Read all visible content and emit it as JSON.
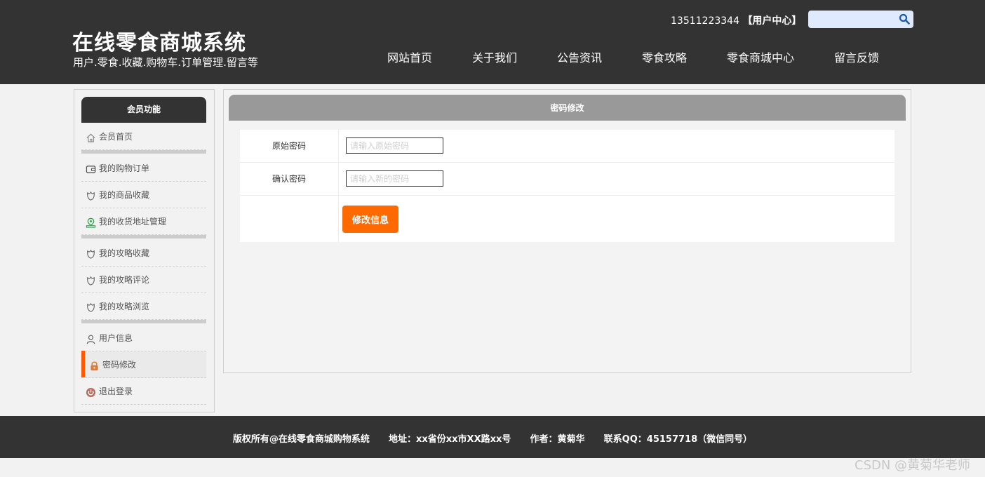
{
  "header": {
    "site_title": "在线零食商城系统",
    "site_subtitle": "用户.零食.收藏.购物车.订单管理.留言等",
    "user_phone": "13511223344",
    "user_center": "【用户中心】",
    "search_placeholder": "",
    "nav": [
      "网站首页",
      "关于我们",
      "公告资讯",
      "零食攻略",
      "零食商城中心",
      "留言反馈"
    ]
  },
  "sidebar": {
    "title": "会员功能",
    "items": [
      {
        "label": "会员首页",
        "icon": "home-icon"
      },
      {
        "label": "我的购物订单",
        "icon": "wallet-icon"
      },
      {
        "label": "我的商品收藏",
        "icon": "flower-icon"
      },
      {
        "label": "我的收货地址管理",
        "icon": "location-icon"
      },
      {
        "label": "我的攻略收藏",
        "icon": "flower-icon"
      },
      {
        "label": "我的攻略评论",
        "icon": "flower-icon"
      },
      {
        "label": "我的攻略浏览",
        "icon": "flower-icon"
      },
      {
        "label": "用户信息",
        "icon": "user-icon"
      },
      {
        "label": "密码修改",
        "icon": "lock-icon",
        "active": true
      },
      {
        "label": "退出登录",
        "icon": "power-icon"
      }
    ]
  },
  "main": {
    "panel_title": "密码修改",
    "fields": [
      {
        "label": "原始密码",
        "placeholder": "请输入原始密码"
      },
      {
        "label": "确认密码",
        "placeholder": "请输入新的密码"
      }
    ],
    "submit_label": "修改信息"
  },
  "footer": {
    "text": "版权所有@在线零食商城购物系统      地址：xx省份xx市XX路xx号      作者：黄菊华      联系QQ：45157718（微信同号）"
  },
  "watermark": "CSDN @黄菊华老师",
  "colors": {
    "header_bg": "#333333",
    "accent": "#ff6a00",
    "active_bar": "#ff5a00",
    "panel_head": "#999999"
  }
}
